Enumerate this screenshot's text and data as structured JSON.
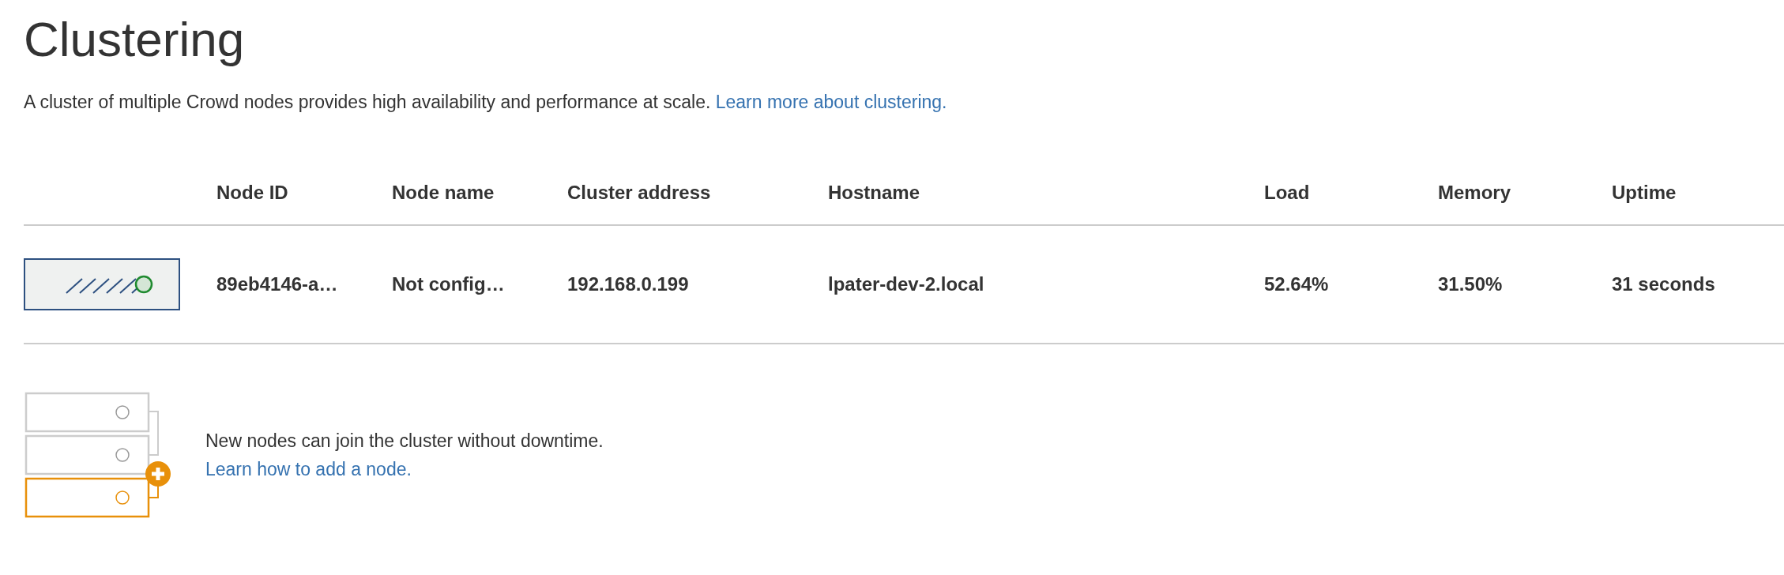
{
  "title": "Clustering",
  "description": {
    "text": "A cluster of multiple Crowd nodes provides high availability and performance at scale.",
    "link": "Learn more about clustering."
  },
  "table": {
    "columns": [
      "Node ID",
      "Node name",
      "Cluster address",
      "Hostname",
      "Load",
      "Memory",
      "Uptime"
    ],
    "rows": [
      {
        "cells": [
          "89eb4146-a…",
          "Not config…",
          "192.168.0.199",
          "lpater-dev-2.local",
          "52.64%",
          "31.50%",
          "31 seconds"
        ]
      }
    ]
  },
  "add_node": {
    "text": "New nodes can join the cluster without downtime.",
    "link": "Learn how to add a node."
  }
}
